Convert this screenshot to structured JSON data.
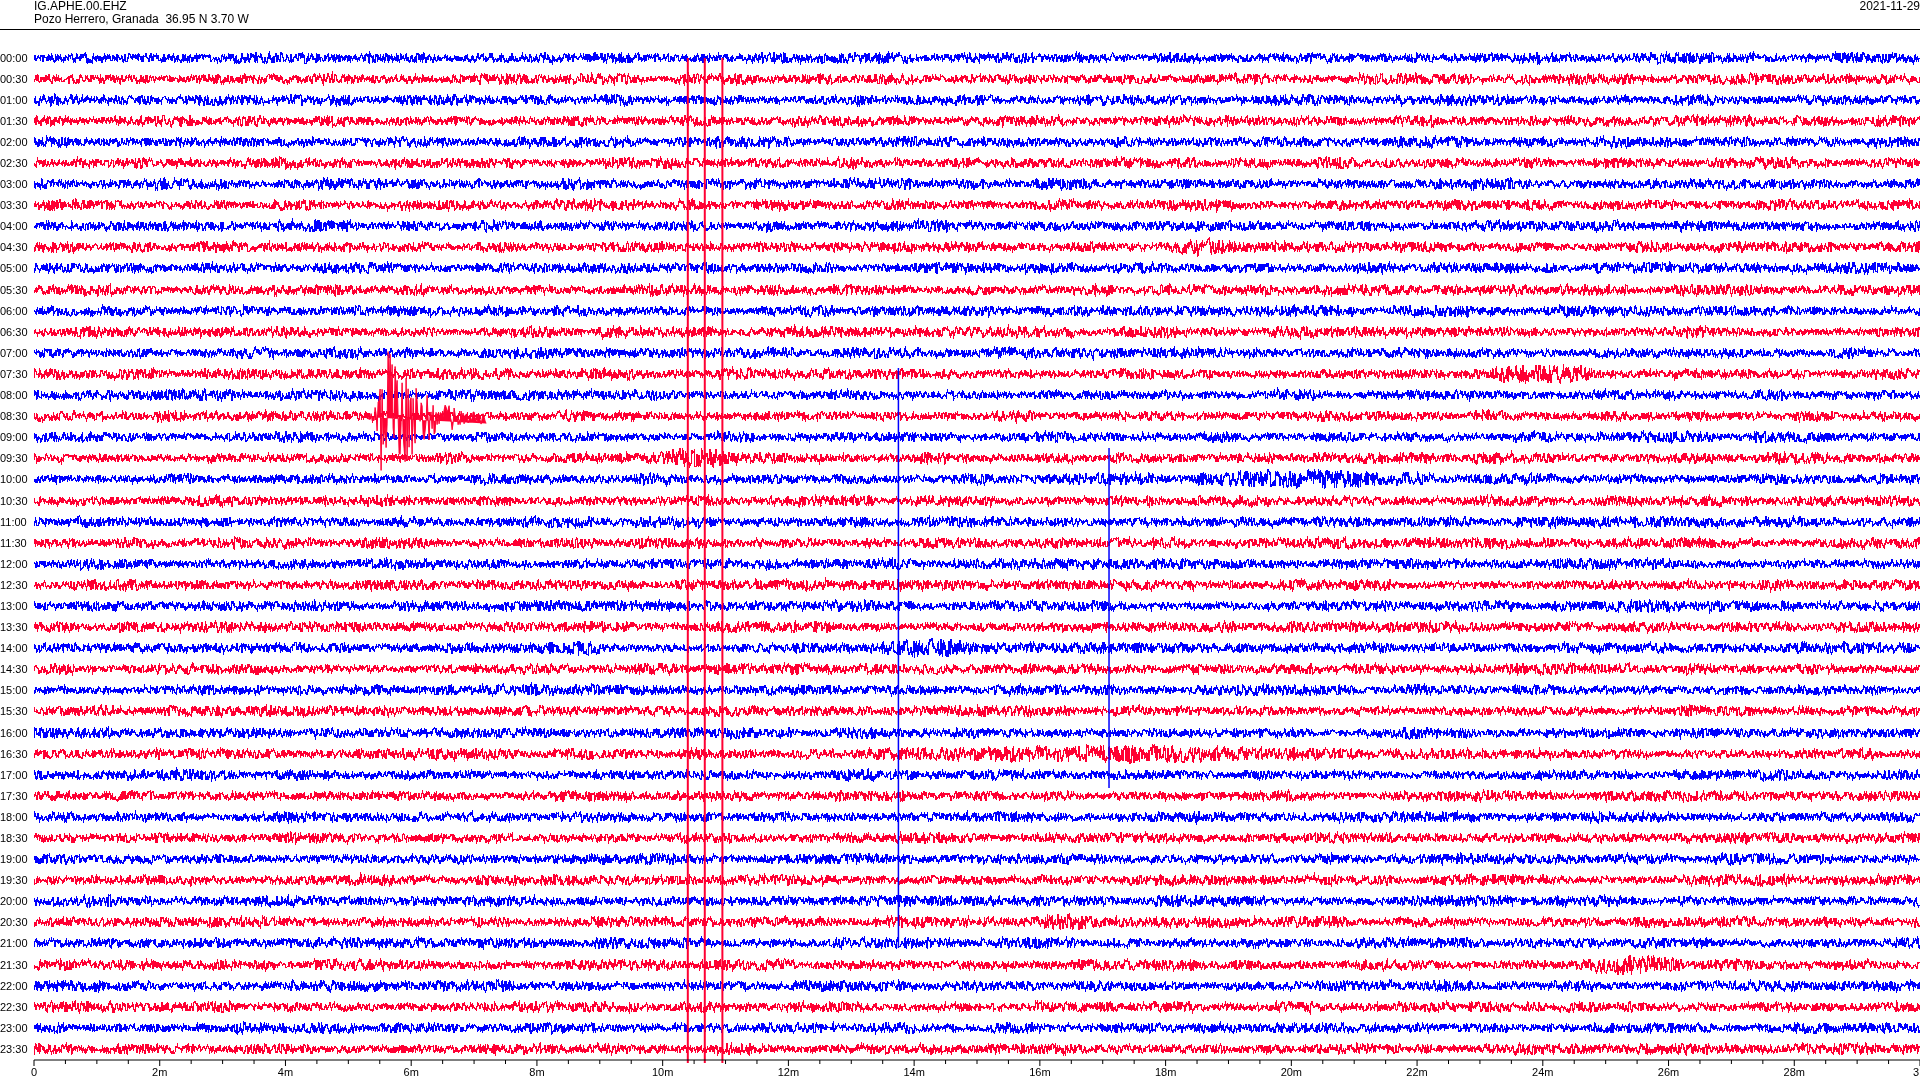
{
  "header": {
    "station": "IG.APHE.00.EHZ",
    "location": "Pozo Herrero, Granada  36.95 N 3.70 W",
    "date": "2021-11-29"
  },
  "rows": [
    {
      "time": "00:00",
      "color": "#0000ff"
    },
    {
      "time": "00:30",
      "color": "#ff0033"
    },
    {
      "time": "01:00",
      "color": "#0000ff"
    },
    {
      "time": "01:30",
      "color": "#ff0033"
    },
    {
      "time": "02:00",
      "color": "#0000ff"
    },
    {
      "time": "02:30",
      "color": "#ff0033"
    },
    {
      "time": "03:00",
      "color": "#0000ff"
    },
    {
      "time": "03:30",
      "color": "#ff0033"
    },
    {
      "time": "04:00",
      "color": "#0000ff"
    },
    {
      "time": "04:30",
      "color": "#ff0033"
    },
    {
      "time": "05:00",
      "color": "#0000ff"
    },
    {
      "time": "05:30",
      "color": "#ff0033"
    },
    {
      "time": "06:00",
      "color": "#0000ff"
    },
    {
      "time": "06:30",
      "color": "#ff0033"
    },
    {
      "time": "07:00",
      "color": "#0000ff"
    },
    {
      "time": "07:30",
      "color": "#ff0033"
    },
    {
      "time": "08:00",
      "color": "#0000ff"
    },
    {
      "time": "08:30",
      "color": "#ff0033"
    },
    {
      "time": "09:00",
      "color": "#0000ff"
    },
    {
      "time": "09:30",
      "color": "#ff0033"
    },
    {
      "time": "10:00",
      "color": "#0000ff"
    },
    {
      "time": "10:30",
      "color": "#ff0033"
    },
    {
      "time": "11:00",
      "color": "#0000ff"
    },
    {
      "time": "11:30",
      "color": "#ff0033"
    },
    {
      "time": "12:00",
      "color": "#0000ff"
    },
    {
      "time": "12:30",
      "color": "#ff0033"
    },
    {
      "time": "13:00",
      "color": "#0000ff"
    },
    {
      "time": "13:30",
      "color": "#ff0033"
    },
    {
      "time": "14:00",
      "color": "#0000ff"
    },
    {
      "time": "14:30",
      "color": "#ff0033"
    },
    {
      "time": "15:00",
      "color": "#0000ff"
    },
    {
      "time": "15:30",
      "color": "#ff0033"
    },
    {
      "time": "16:00",
      "color": "#0000ff"
    },
    {
      "time": "16:30",
      "color": "#ff0033"
    },
    {
      "time": "17:00",
      "color": "#0000ff"
    },
    {
      "time": "17:30",
      "color": "#ff0033"
    },
    {
      "time": "18:00",
      "color": "#0000ff"
    },
    {
      "time": "18:30",
      "color": "#ff0033"
    },
    {
      "time": "19:00",
      "color": "#0000ff"
    },
    {
      "time": "19:30",
      "color": "#ff0033"
    },
    {
      "time": "20:00",
      "color": "#0000ff"
    },
    {
      "time": "20:30",
      "color": "#ff0033"
    },
    {
      "time": "21:00",
      "color": "#0000ff"
    },
    {
      "time": "21:30",
      "color": "#ff0033"
    },
    {
      "time": "22:00",
      "color": "#0000ff"
    },
    {
      "time": "22:30",
      "color": "#ff0033"
    },
    {
      "time": "23:00",
      "color": "#0000ff"
    },
    {
      "time": "23:30",
      "color": "#ff0033"
    }
  ],
  "x_axis": {
    "labels": [
      "0",
      "2m",
      "4m",
      "6m",
      "8m",
      "10m",
      "12m",
      "14m",
      "16m",
      "18m",
      "20m",
      "22m",
      "24m",
      "26m",
      "28m",
      "3"
    ]
  }
}
